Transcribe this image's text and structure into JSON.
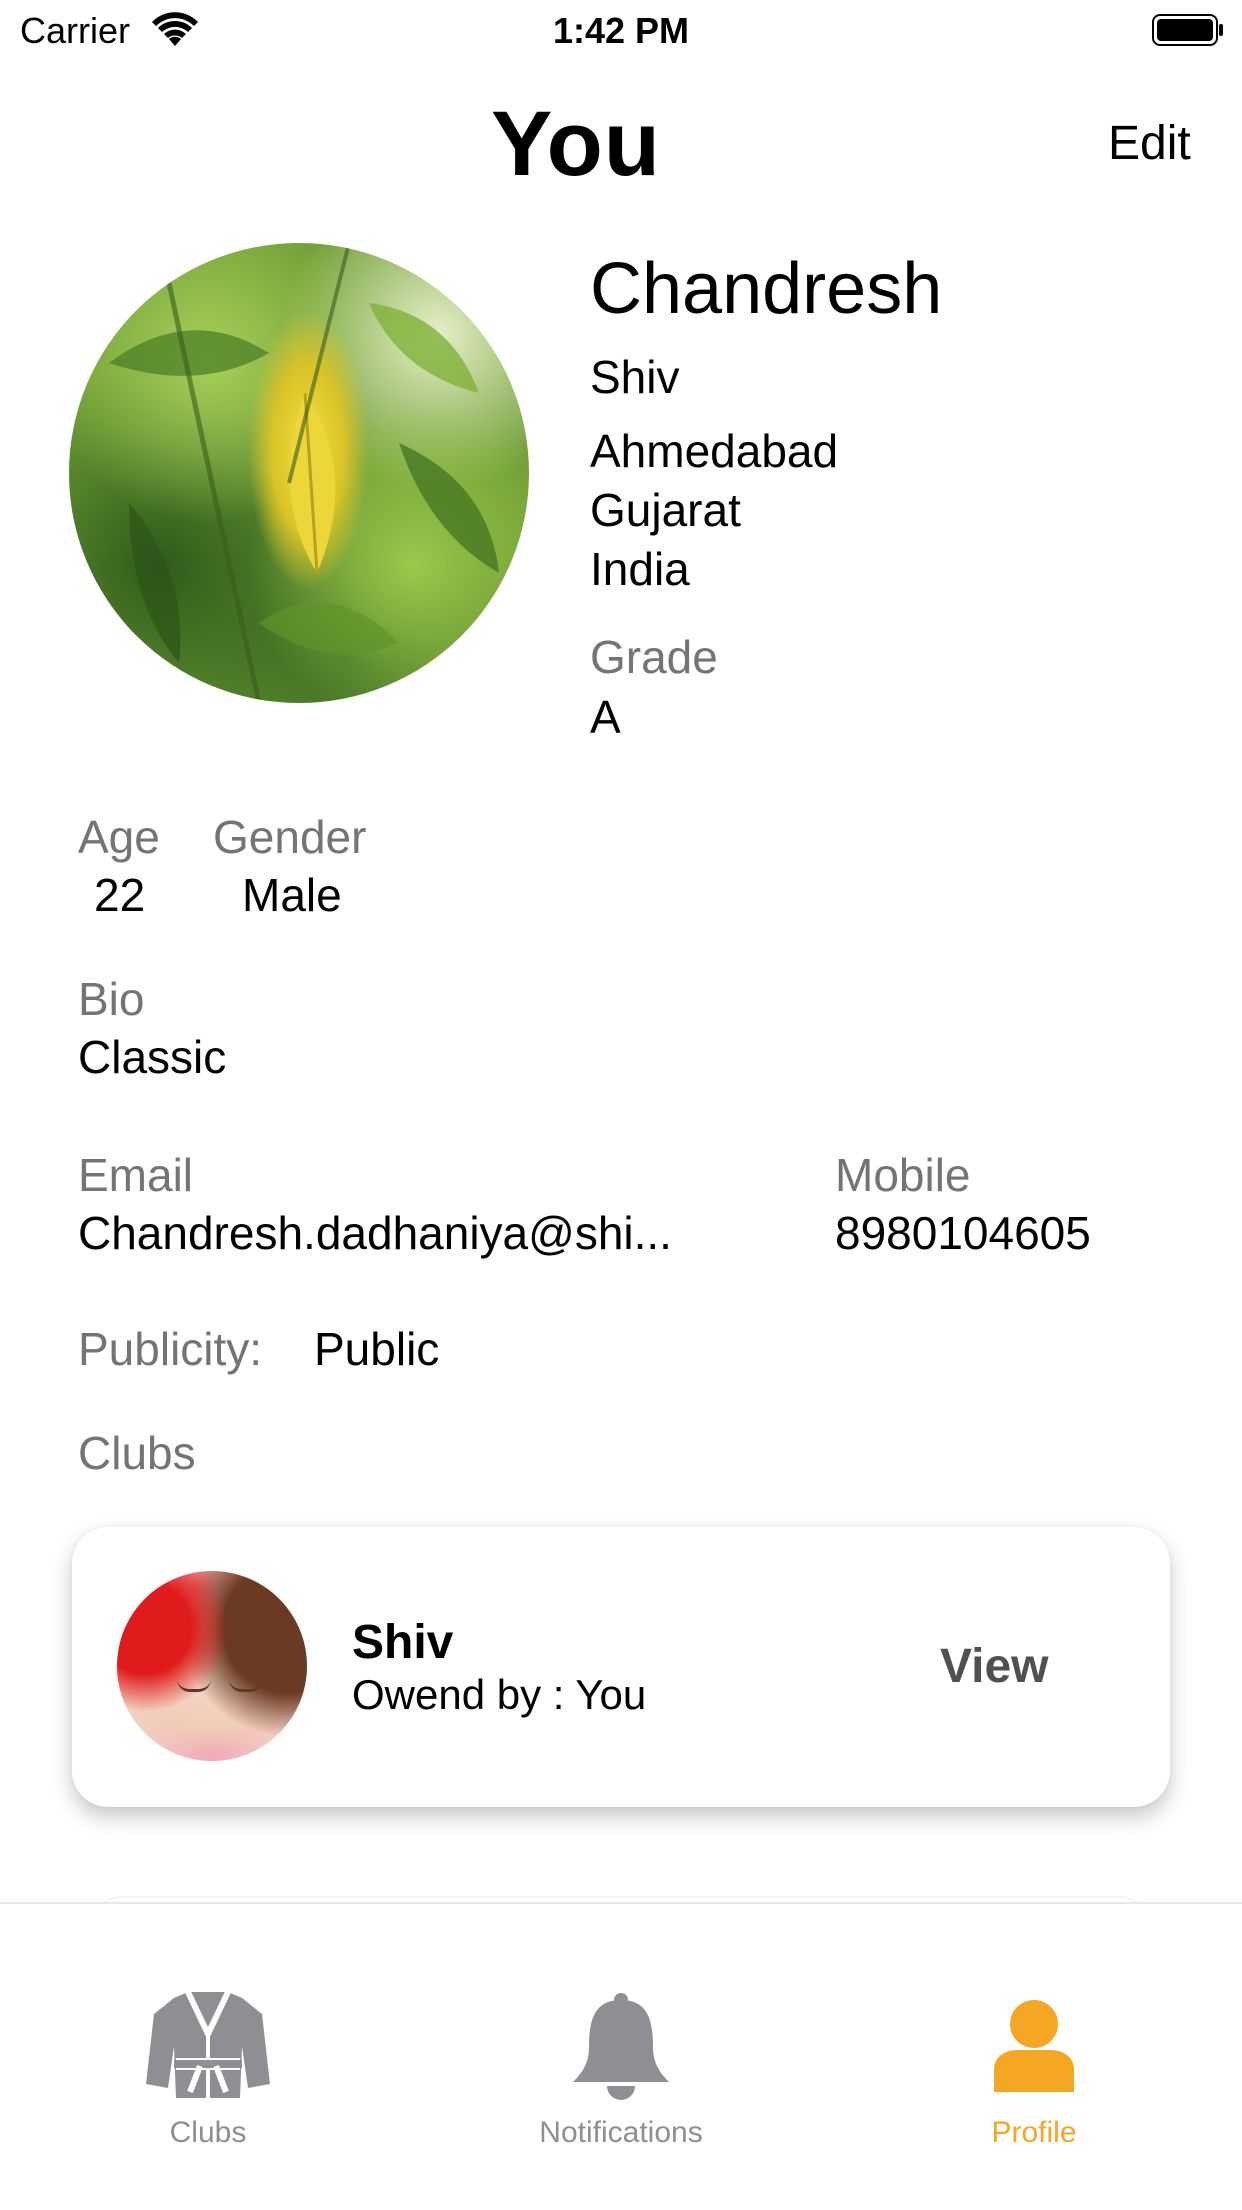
{
  "status_bar": {
    "carrier": "Carrier",
    "time": "1:42 PM"
  },
  "nav": {
    "title": "You",
    "edit_label": "Edit"
  },
  "profile": {
    "first_name": "Chandresh",
    "last_name": "Shiv",
    "city": "Ahmedabad",
    "state": "Gujarat",
    "country": "India",
    "grade_label": "Grade",
    "grade_value": "A",
    "age_label": "Age",
    "age_value": "22",
    "gender_label": "Gender",
    "gender_value": "Male",
    "bio_label": "Bio",
    "bio_value": "Classic",
    "email_label": "Email",
    "email_value": "Chandresh.dadhaniya@shi...",
    "mobile_label": "Mobile",
    "mobile_value": "8980104605",
    "publicity_label": "Publicity:",
    "publicity_value": "Public"
  },
  "clubs": {
    "section_label": "Clubs",
    "items": [
      {
        "name": "Shiv",
        "owner": "Owend by : You",
        "action": "View"
      }
    ]
  },
  "tabbar": {
    "tabs": [
      {
        "label": "Clubs",
        "icon": "karate-gi-icon"
      },
      {
        "label": "Notifications",
        "icon": "bell-icon"
      },
      {
        "label": "Profile",
        "icon": "person-icon"
      }
    ],
    "active_color": "#f5a623",
    "inactive_color": "#8e8e93"
  }
}
